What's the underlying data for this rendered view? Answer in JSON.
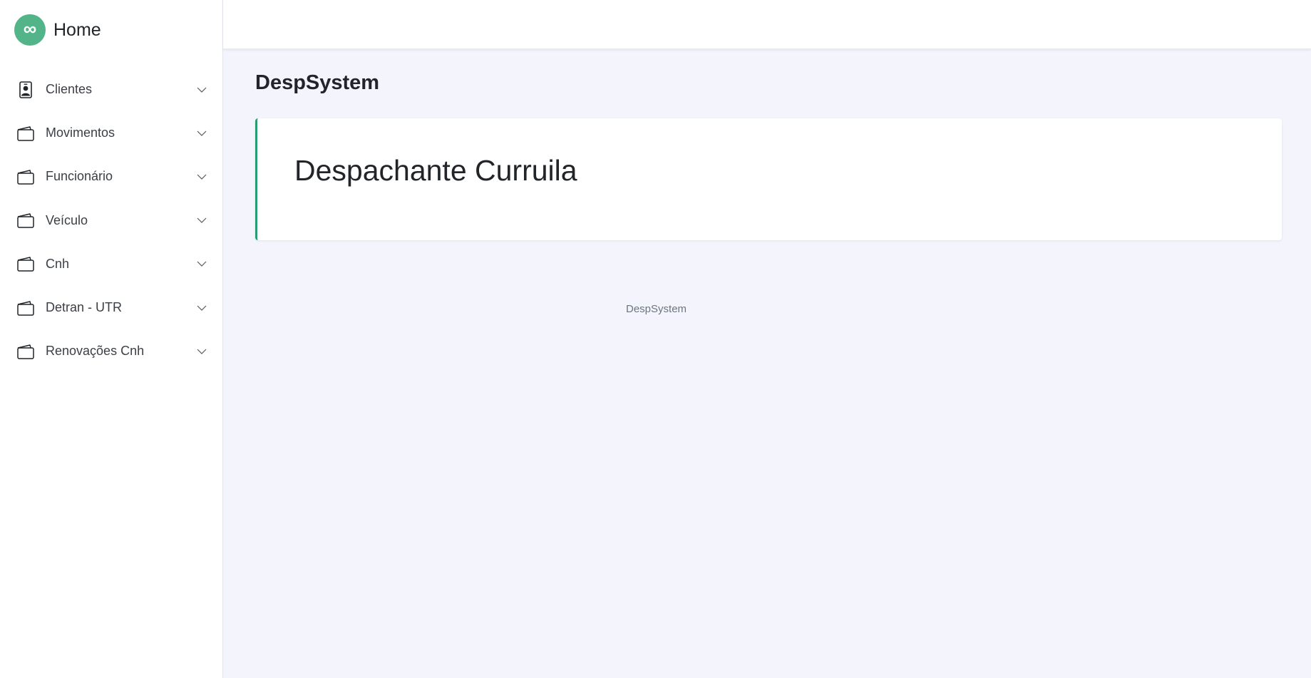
{
  "brand": {
    "logo_glyph": "∞",
    "title": "Home",
    "logo_color": "#52b488"
  },
  "sidebar": {
    "items": [
      {
        "label": "Clientes",
        "icon": "person-badge-icon"
      },
      {
        "label": "Movimentos",
        "icon": "wallet-icon"
      },
      {
        "label": "Funcionário",
        "icon": "wallet-icon"
      },
      {
        "label": "Veículo",
        "icon": "wallet-icon"
      },
      {
        "label": "Cnh",
        "icon": "wallet-icon"
      },
      {
        "label": "Detran - UTR",
        "icon": "wallet-icon"
      },
      {
        "label": "Renovações Cnh",
        "icon": "wallet-icon"
      }
    ]
  },
  "main": {
    "page_title": "DespSystem",
    "card_heading": "Despachante Curruila",
    "accent_color": "#2a9d70"
  },
  "footer": {
    "text": "DespSystem"
  }
}
